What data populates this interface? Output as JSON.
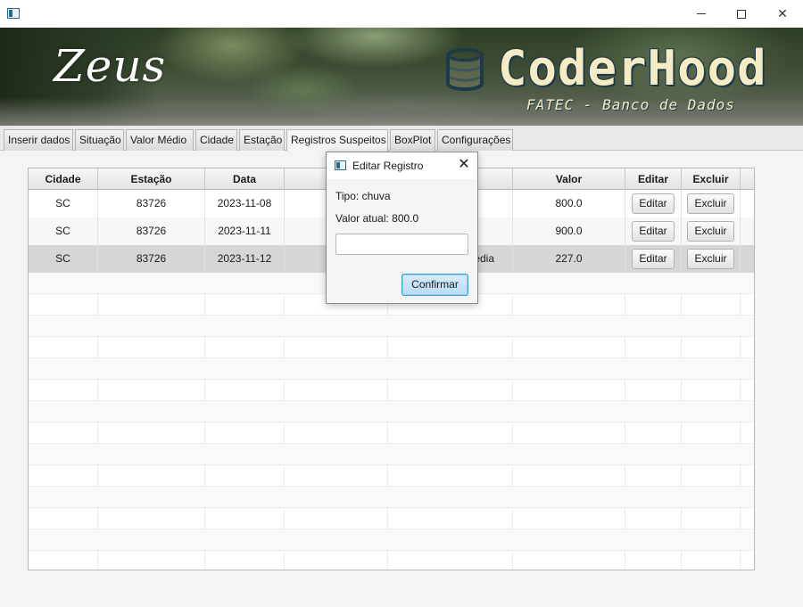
{
  "window": {
    "icon": "app-window-icon",
    "minimize": "minimize-icon",
    "maximize": "maximize-icon",
    "close_glyph": "✕"
  },
  "banner": {
    "logo_left": "Zeus",
    "brand": "CoderHood",
    "subtitle": "FATEC - Banco de Dados",
    "db_icon": "database-icon"
  },
  "tabs": [
    {
      "label": "Inserir dados"
    },
    {
      "label": "Situação"
    },
    {
      "label": "Valor Médio"
    },
    {
      "label": "Cidade"
    },
    {
      "label": "Estação"
    },
    {
      "label": "Registros Suspeitos",
      "active": true
    },
    {
      "label": "BoxPlot"
    },
    {
      "label": "Configurações"
    }
  ],
  "table": {
    "headers": [
      "Cidade",
      "Estação",
      "Data",
      "",
      "",
      "Valor",
      "Editar",
      "Excluir"
    ],
    "rows": [
      {
        "cidade": "SC",
        "estacao": "83726",
        "data": "2023-11-08",
        "col4": "",
        "col5": "",
        "valor": "800.0",
        "editar": "Editar",
        "excluir": "Excluir"
      },
      {
        "cidade": "SC",
        "estacao": "83726",
        "data": "2023-11-11",
        "col4": "",
        "col5": "",
        "valor": "900.0",
        "editar": "Editar",
        "excluir": "Excluir"
      },
      {
        "cidade": "SC",
        "estacao": "83726",
        "data": "2023-11-12",
        "col4": "",
        "col5": "edia",
        "valor": "227.0",
        "editar": "Editar",
        "excluir": "Excluir",
        "selected": true
      }
    ]
  },
  "dialog": {
    "title": "Editar Registro",
    "close_glyph": "✕",
    "tipo_label": "Tipo: chuva",
    "valor_label": "Valor atual: 800.0",
    "input_value": "",
    "confirm_label": "Confirmar"
  },
  "colors": {
    "brand_text": "#f5ecc4",
    "brand_outline": "#1d3a4a",
    "confirm_border": "#3b9ad4",
    "selected_row": "#d6d6d6"
  }
}
